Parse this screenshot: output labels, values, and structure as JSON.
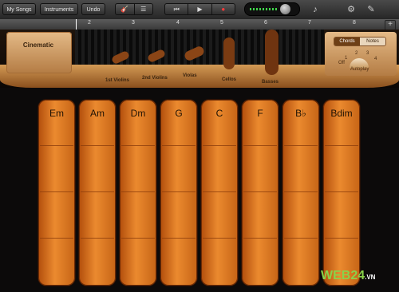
{
  "toolbar": {
    "my_songs": "My Songs",
    "instruments": "Instruments",
    "undo": "Undo",
    "transport": {
      "rewind": "⏮",
      "play": "▶",
      "record": "●"
    },
    "icons": {
      "instrument-view": "instrument-view-icon",
      "tracks-view": "tracks-view-icon",
      "metronome": "metronome-icon",
      "mixer": "mixer-icon",
      "settings": "wrench-icon"
    }
  },
  "ruler": {
    "numbers": [
      "2",
      "3",
      "4",
      "5",
      "6",
      "7",
      "8"
    ],
    "add": "+"
  },
  "stage": {
    "preset": "Cinematic",
    "instruments": [
      "1st Violins",
      "2nd Violins",
      "Violas",
      "Cellos",
      "Basses"
    ],
    "toggle": {
      "chords": "Chords",
      "notes": "Notes"
    },
    "dial": {
      "labels": [
        "Off",
        "1",
        "2",
        "3",
        "4"
      ],
      "autoplay": "Autoplay"
    }
  },
  "chords": [
    "Em",
    "Am",
    "Dm",
    "G",
    "C",
    "F",
    "B♭",
    "Bdim"
  ],
  "watermark": {
    "brand": "WEB24",
    "tld": ".VN"
  },
  "colors": {
    "accent": "#e07a22",
    "led": "#3fd64a"
  }
}
